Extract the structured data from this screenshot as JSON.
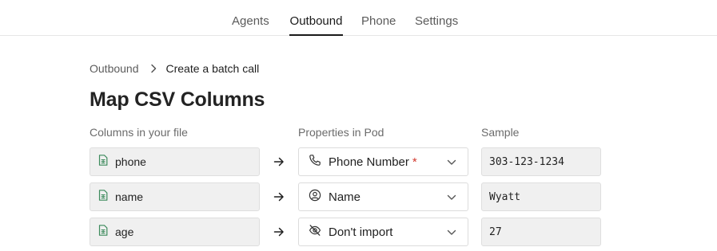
{
  "nav": {
    "tabs": [
      {
        "label": "Agents",
        "active": false
      },
      {
        "label": "Outbound",
        "active": true
      },
      {
        "label": "Phone",
        "active": false
      },
      {
        "label": "Settings",
        "active": false
      }
    ]
  },
  "breadcrumb": {
    "parent": "Outbound",
    "current": "Create a batch call"
  },
  "page": {
    "title": "Map CSV Columns"
  },
  "table": {
    "headers": {
      "columns": "Columns in your file",
      "properties": "Properties in Pod",
      "sample": "Sample"
    },
    "rows": [
      {
        "file_column": "phone",
        "property": "Phone Number",
        "required_mark": "*",
        "property_icon": "phone-icon",
        "sample": "303-123-1234"
      },
      {
        "file_column": "name",
        "property": "Name",
        "required_mark": "",
        "property_icon": "user-circle-icon",
        "sample": "Wyatt"
      },
      {
        "file_column": "age",
        "property": "Don't import",
        "required_mark": "",
        "property_icon": "eye-off-icon",
        "sample": "27"
      }
    ]
  },
  "colors": {
    "accent_green": "#3c8a5c",
    "required_red": "#d23a2f",
    "field_bg": "#f0f0f0"
  }
}
